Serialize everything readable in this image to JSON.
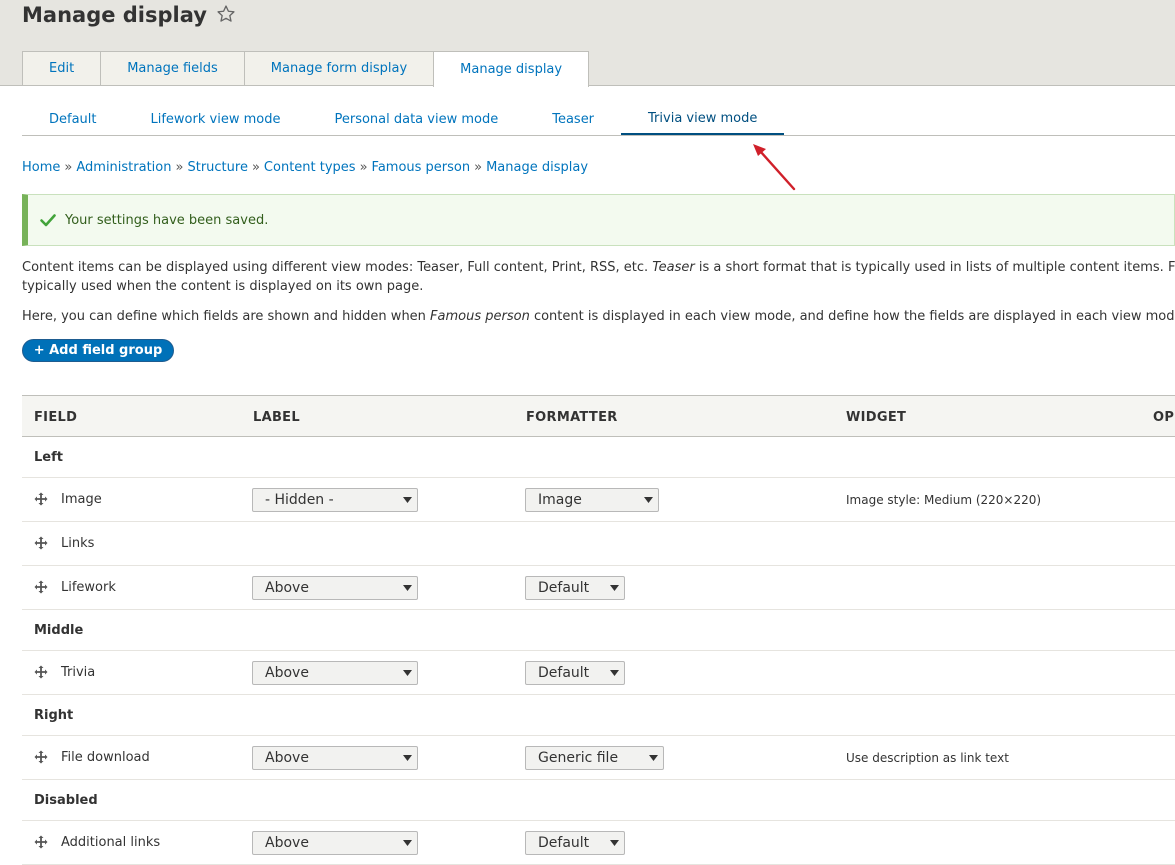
{
  "header": {
    "title": "Manage display",
    "primary_tabs": [
      {
        "label": "Edit",
        "active": false
      },
      {
        "label": "Manage fields",
        "active": false
      },
      {
        "label": "Manage form display",
        "active": false
      },
      {
        "label": "Manage display",
        "active": true
      }
    ]
  },
  "secondary_tabs": [
    {
      "label": "Default",
      "active": false
    },
    {
      "label": "Lifework view mode",
      "active": false
    },
    {
      "label": "Personal data view mode",
      "active": false
    },
    {
      "label": "Teaser",
      "active": false
    },
    {
      "label": "Trivia view mode",
      "active": true
    }
  ],
  "breadcrumb": [
    "Home",
    "Administration",
    "Structure",
    "Content types",
    "Famous person",
    "Manage display"
  ],
  "breadcrumb_separator": "»",
  "message": {
    "text": "Your settings have been saved.",
    "type": "status"
  },
  "description": {
    "line1_a": "Content items can be displayed using different view modes: Teaser, Full content, Print, RSS, etc. ",
    "line1_em": "Teaser",
    "line1_b": " is a short format that is typically used in lists of multiple content items. F",
    "line1_c": "typically used when the content is displayed on its own page.",
    "line2_a": "Here, you can define which fields are shown and hidden when ",
    "line2_em": "Famous person",
    "line2_b": " content is displayed in each view mode, and define how the fields are displayed in each view mod"
  },
  "add_field_group_label": "+ Add field group",
  "table": {
    "headers": [
      "FIELD",
      "LABEL",
      "FORMATTER",
      "WIDGET",
      "OP"
    ],
    "rows": [
      {
        "type": "region",
        "label": "Left"
      },
      {
        "type": "field",
        "label": "Image",
        "label_select": "- Hidden -",
        "formatter": "Image",
        "widget": "Image style: Medium (220×220)"
      },
      {
        "type": "field",
        "label": "Links",
        "label_select": "",
        "formatter": "",
        "widget": ""
      },
      {
        "type": "field",
        "label": "Lifework",
        "label_select": "Above",
        "formatter": "Default",
        "widget": ""
      },
      {
        "type": "region",
        "label": "Middle"
      },
      {
        "type": "field",
        "label": "Trivia",
        "label_select": "Above",
        "formatter": "Default",
        "widget": ""
      },
      {
        "type": "region",
        "label": "Right"
      },
      {
        "type": "field",
        "label": "File download",
        "label_select": "Above",
        "formatter": "Generic file",
        "widget": "Use description as link text"
      },
      {
        "type": "region",
        "label": "Disabled"
      },
      {
        "type": "field",
        "label": "Additional links",
        "label_select": "Above",
        "formatter": "Default",
        "widget": ""
      }
    ]
  },
  "colors": {
    "link": "#0074bd",
    "button": "#0071b8",
    "success_border": "#77b259",
    "annotation_arrow": "#d0202a"
  }
}
